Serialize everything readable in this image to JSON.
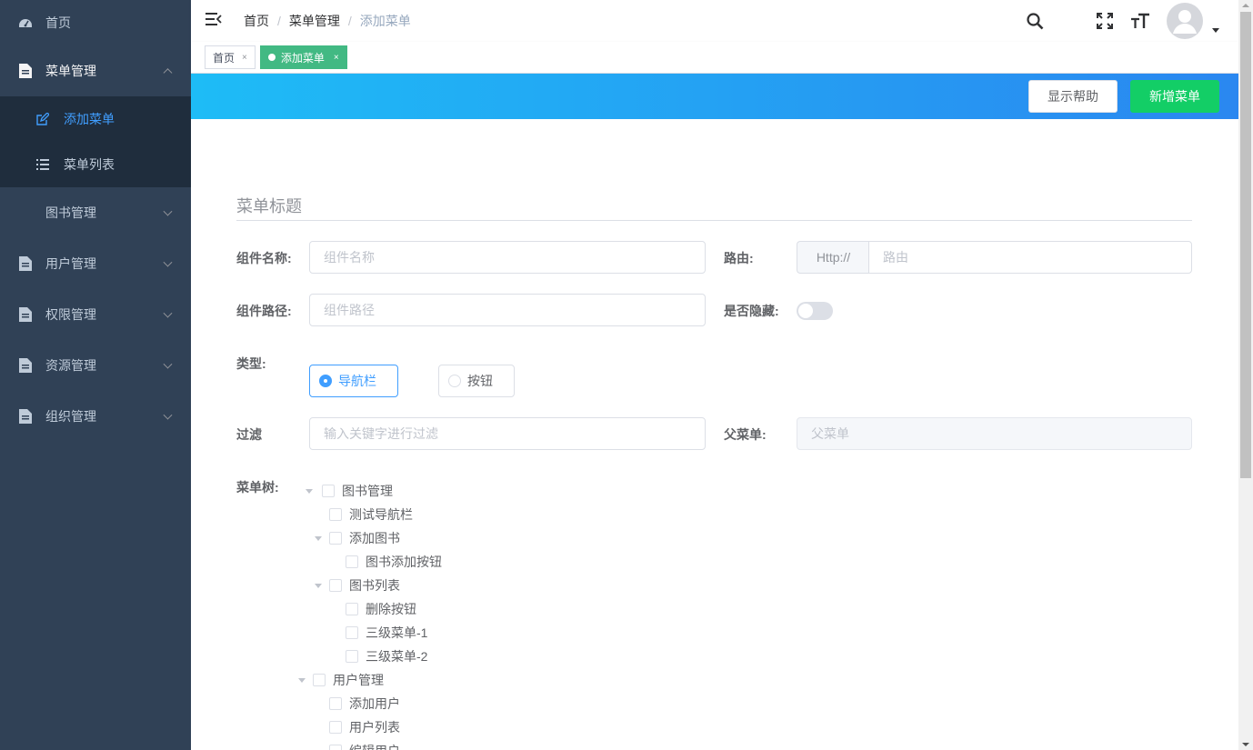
{
  "sidebar": {
    "items": [
      {
        "label": "首页",
        "icon": "dashboard-icon"
      },
      {
        "label": "菜单管理",
        "icon": "document-icon",
        "expanded": true,
        "children": [
          {
            "label": "添加菜单",
            "icon": "edit-icon",
            "active": true
          },
          {
            "label": "菜单列表",
            "icon": "list-icon"
          }
        ]
      },
      {
        "label": "图书管理",
        "icon": ""
      },
      {
        "label": "用户管理",
        "icon": "document-icon"
      },
      {
        "label": "权限管理",
        "icon": "document-icon"
      },
      {
        "label": "资源管理",
        "icon": "document-icon"
      },
      {
        "label": "组织管理",
        "icon": "document-icon"
      }
    ],
    "colors": {
      "background": "#304156",
      "submenu_background": "#1f2d3d",
      "active_text": "#409eff"
    }
  },
  "header": {
    "breadcrumb": [
      "首页",
      "菜单管理",
      "添加菜单"
    ],
    "separator": "/"
  },
  "tags": [
    {
      "label": "首页",
      "active": false,
      "close": "×"
    },
    {
      "label": "添加菜单",
      "active": true,
      "close": "×"
    }
  ],
  "toolbar": {
    "help_label": "显示帮助",
    "new_label": "新增菜单",
    "accent": "#13ce66"
  },
  "form": {
    "section_title": "菜单标题",
    "component_name": {
      "label": "组件名称:",
      "placeholder": "组件名称"
    },
    "route": {
      "label": "路由:",
      "prepend": "Http://",
      "placeholder": "路由"
    },
    "component_path": {
      "label": "组件路径:",
      "placeholder": "组件路径"
    },
    "hidden": {
      "label": "是否隐藏:",
      "value": false
    },
    "type": {
      "label": "类型:",
      "options": [
        "导航栏",
        "按钮"
      ],
      "selected": "导航栏"
    },
    "filter": {
      "label": "过滤",
      "placeholder": "输入关键字进行过滤"
    },
    "parent": {
      "label": "父菜单:",
      "placeholder": "父菜单"
    },
    "tree_label": "菜单树:",
    "tree": [
      {
        "label": "图书管理",
        "level": 0,
        "expandable": true
      },
      {
        "label": "测试导航栏",
        "level": 1,
        "expandable": false
      },
      {
        "label": "添加图书",
        "level": 1,
        "expandable": true
      },
      {
        "label": "图书添加按钮",
        "level": 2,
        "expandable": false
      },
      {
        "label": "图书列表",
        "level": 1,
        "expandable": true
      },
      {
        "label": "删除按钮",
        "level": 2,
        "expandable": false
      },
      {
        "label": "三级菜单-1",
        "level": 2,
        "expandable": false
      },
      {
        "label": "三级菜单-2",
        "level": 2,
        "expandable": false
      },
      {
        "label": "用户管理",
        "level": 0,
        "expandable": true
      },
      {
        "label": "添加用户",
        "level": 1,
        "expandable": false
      },
      {
        "label": "用户列表",
        "level": 1,
        "expandable": false
      },
      {
        "label": "编辑用户",
        "level": 1,
        "expandable": false
      }
    ]
  }
}
